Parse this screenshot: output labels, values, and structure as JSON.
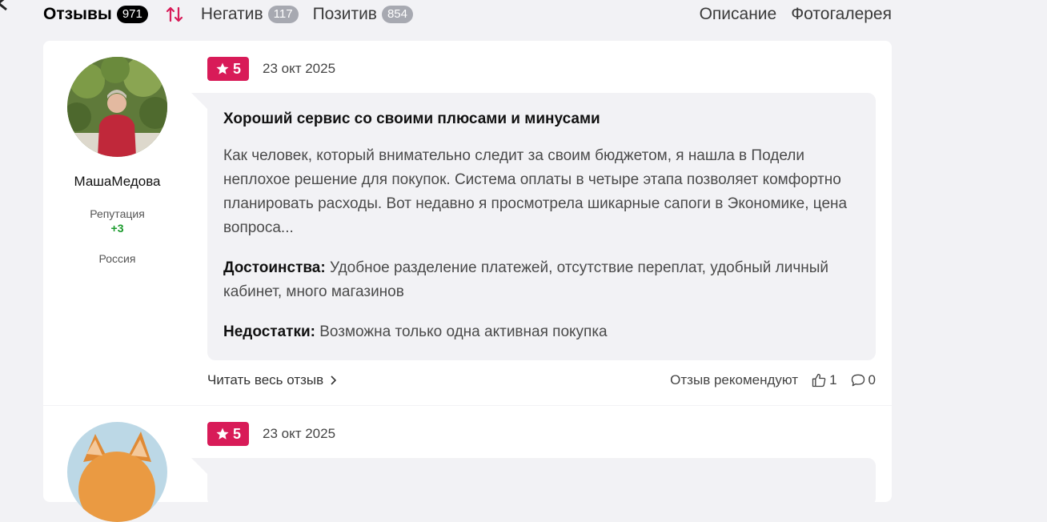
{
  "tabs": {
    "reviews": {
      "label": "Отзывы",
      "count": "971"
    },
    "negative": {
      "label": "Негатив",
      "count": "117"
    },
    "positive": {
      "label": "Позитив",
      "count": "854"
    },
    "description": "Описание",
    "gallery": "Фотогалерея"
  },
  "colors": {
    "accent": "#d81b58",
    "reputation": "#1a9a2c",
    "badge": "#a7a9b1"
  },
  "reviews": [
    {
      "author": "МашаМедова",
      "reputation_label": "Репутация",
      "reputation_value": "+3",
      "country": "Россия",
      "rating": "5",
      "date": "23 окт 2025",
      "title": "Хороший сервис со своими плюсами и минусами",
      "text": "Как человек, который внимательно следит за своим бюджетом, я нашла в Подели неплохое решение для покупок. Система оплаты в четыре этапа позволяет комфортно планировать расходы. Вот недавно я просмотрела шикарные сапоги в Экономике, цена вопроса...",
      "pros_label": "Достоинства:",
      "pros": "Удобное разделение платежей, отсутствие переплат, удобный личный кабинет, много магазинов",
      "cons_label": "Недостатки:",
      "cons": "Возможна только одна активная покупка",
      "read_more": "Читать весь отзыв",
      "recommend": "Отзыв рекомендуют",
      "likes": "1",
      "comments": "0"
    },
    {
      "rating": "5",
      "date": "23 окт 2025"
    }
  ],
  "icons": [
    "sort-arrows-icon",
    "star-icon",
    "chevron-right-icon",
    "thumbs-up-icon",
    "comment-icon"
  ]
}
